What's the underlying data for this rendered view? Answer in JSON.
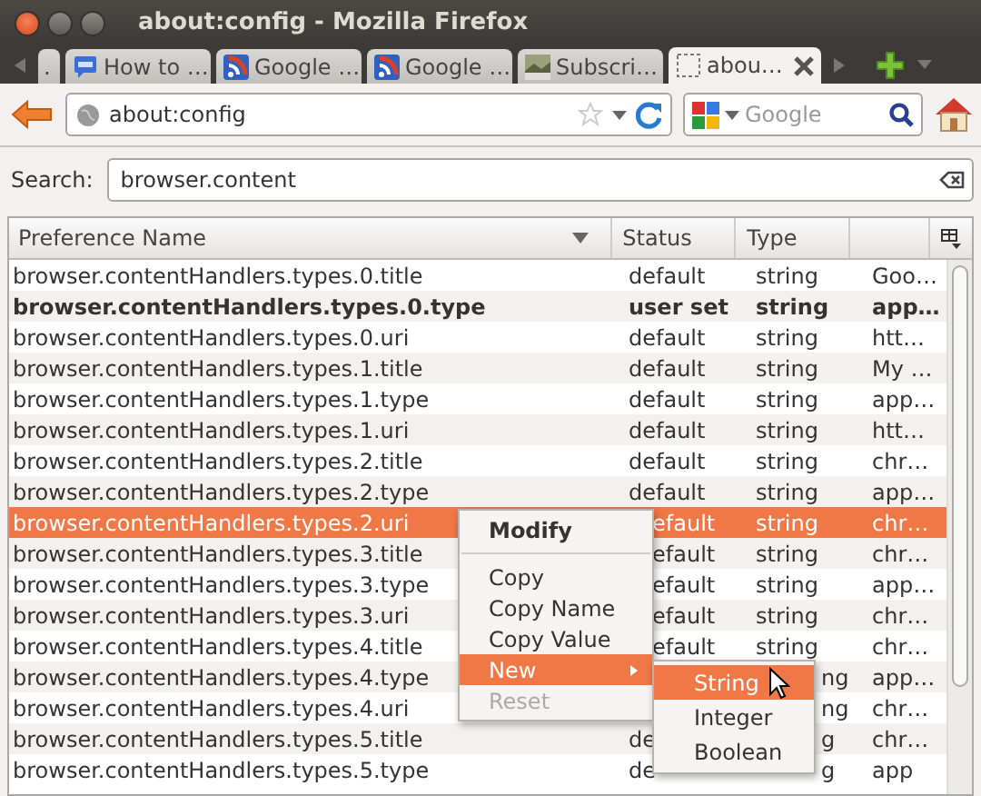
{
  "window": {
    "title": "about:config - Mozilla Firefox"
  },
  "tabs": [
    {
      "label": ".",
      "kind": "none",
      "selected": false
    },
    {
      "label": "How to …",
      "kind": "chat",
      "selected": false
    },
    {
      "label": "Google …",
      "kind": "feed",
      "selected": false
    },
    {
      "label": "Google …",
      "kind": "feed",
      "selected": false
    },
    {
      "label": "Subscri…",
      "kind": "picture",
      "selected": false
    },
    {
      "label": "abou…",
      "kind": "blank",
      "selected": true
    }
  ],
  "nav": {
    "url": "about:config",
    "search_placeholder": "Google"
  },
  "filter": {
    "label": "Search:",
    "value": "browser.content"
  },
  "table": {
    "columns": [
      {
        "label": "Preference Name",
        "sorted": true
      },
      {
        "label": "Status",
        "sorted": false
      },
      {
        "label": "Type",
        "sorted": false
      }
    ],
    "rows": [
      {
        "name": "browser.contentHandlers.types.0.title",
        "status": "default",
        "type": "string",
        "value": "Goo…",
        "bold": false,
        "selected": false
      },
      {
        "name": "browser.contentHandlers.types.0.type",
        "status": "user set",
        "type": "string",
        "value": "app…",
        "bold": true,
        "selected": false
      },
      {
        "name": "browser.contentHandlers.types.0.uri",
        "status": "default",
        "type": "string",
        "value": "htt…",
        "bold": false,
        "selected": false
      },
      {
        "name": "browser.contentHandlers.types.1.title",
        "status": "default",
        "type": "string",
        "value": "My …",
        "bold": false,
        "selected": false
      },
      {
        "name": "browser.contentHandlers.types.1.type",
        "status": "default",
        "type": "string",
        "value": "app…",
        "bold": false,
        "selected": false
      },
      {
        "name": "browser.contentHandlers.types.1.uri",
        "status": "default",
        "type": "string",
        "value": "htt…",
        "bold": false,
        "selected": false
      },
      {
        "name": "browser.contentHandlers.types.2.title",
        "status": "default",
        "type": "string",
        "value": "chr…",
        "bold": false,
        "selected": false
      },
      {
        "name": "browser.contentHandlers.types.2.type",
        "status": "default",
        "type": "string",
        "value": "app…",
        "bold": false,
        "selected": false
      },
      {
        "name": "browser.contentHandlers.types.2.uri",
        "status": "efault",
        "type": "string",
        "value": "chr…",
        "bold": false,
        "selected": true
      },
      {
        "name": "browser.contentHandlers.types.3.title",
        "status": "efault",
        "type": "string",
        "value": "chr…",
        "bold": false,
        "selected": false
      },
      {
        "name": "browser.contentHandlers.types.3.type",
        "status": "efault",
        "type": "string",
        "value": "app…",
        "bold": false,
        "selected": false
      },
      {
        "name": "browser.contentHandlers.types.3.uri",
        "status": "efault",
        "type": "string",
        "value": "chr…",
        "bold": false,
        "selected": false
      },
      {
        "name": "browser.contentHandlers.types.4.title",
        "status": "efault",
        "type": "string",
        "value": "chr…",
        "bold": false,
        "selected": false
      },
      {
        "name": "browser.contentHandlers.types.4.type",
        "type": "ng",
        "value": "app…",
        "bold": false,
        "selected": false
      },
      {
        "name": "browser.contentHandlers.types.4.uri",
        "type": "ng",
        "value": "chr…",
        "bold": false,
        "selected": false
      },
      {
        "name": "browser.contentHandlers.types.5.title",
        "status": "de",
        "type": "g",
        "value": "chr…",
        "bold": false,
        "selected": false
      },
      {
        "name": "browser.contentHandlers.types.5.type",
        "status": "de",
        "type": "g",
        "value": "app",
        "bold": false,
        "selected": false
      }
    ]
  },
  "context_menu": {
    "items": [
      {
        "kind": "item",
        "label": "Modify",
        "bold": true,
        "selected": false,
        "disabled": false
      },
      {
        "kind": "separator"
      },
      {
        "kind": "item",
        "label": "Copy",
        "bold": false,
        "selected": false,
        "disabled": false
      },
      {
        "kind": "item",
        "label": "Copy Name",
        "bold": false,
        "selected": false,
        "disabled": false
      },
      {
        "kind": "item",
        "label": "Copy Value",
        "bold": false,
        "selected": false,
        "disabled": false
      },
      {
        "kind": "submenu",
        "label": "New",
        "bold": false,
        "selected": true,
        "disabled": false,
        "children": [
          {
            "label": "String",
            "selected": true
          },
          {
            "label": "Integer",
            "selected": false
          },
          {
            "label": "Boolean",
            "selected": false
          }
        ]
      },
      {
        "kind": "item",
        "label": "Reset",
        "bold": false,
        "selected": false,
        "disabled": true
      }
    ]
  }
}
